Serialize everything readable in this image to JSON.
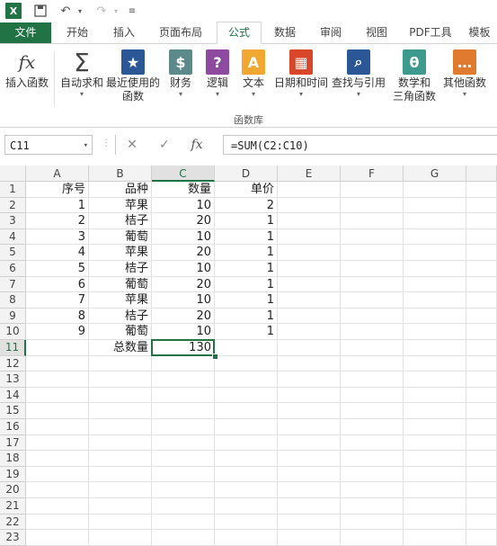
{
  "qat": {
    "logo": "X",
    "undo": "↶",
    "redo": "↷"
  },
  "tabs": [
    "文件",
    "开始",
    "插入",
    "页面布局",
    "公式",
    "数据",
    "审阅",
    "视图",
    "PDF工具",
    "模板"
  ],
  "ribbon": {
    "buttons": [
      {
        "label": "插入函数",
        "icon": "fx"
      },
      {
        "label": "自动求和",
        "icon": "Σ"
      },
      {
        "label": "最近使用的",
        "label2": "函数",
        "icon": "★"
      },
      {
        "label": "财务",
        "icon": "$"
      },
      {
        "label": "逻辑",
        "icon": "?"
      },
      {
        "label": "文本",
        "icon": "A"
      },
      {
        "label": "日期和时间",
        "icon": "▦"
      },
      {
        "label": "查找与引用",
        "icon": "⌕"
      },
      {
        "label": "数学和",
        "label2": "三角函数",
        "icon": "θ"
      },
      {
        "label": "其他函数",
        "icon": "…"
      }
    ],
    "group_label": "函数库"
  },
  "formula_bar": {
    "namebox": "C11",
    "cancel": "✕",
    "enter": "✓",
    "fx": "fx",
    "formula": "=SUM(C2:C10)"
  },
  "columns": [
    "A",
    "B",
    "C",
    "D",
    "E",
    "F",
    "G"
  ],
  "rows": [
    "1",
    "2",
    "3",
    "4",
    "5",
    "6",
    "7",
    "8",
    "9",
    "10",
    "11",
    "12",
    "13",
    "14",
    "15",
    "16",
    "17",
    "18",
    "19",
    "20",
    "21",
    "22",
    "23"
  ],
  "cells": {
    "r1": [
      "序号",
      "品种",
      "数量",
      "单价"
    ],
    "data": [
      [
        "1",
        "苹果",
        "10",
        "2"
      ],
      [
        "2",
        "桔子",
        "20",
        "1"
      ],
      [
        "3",
        "葡萄",
        "10",
        "1"
      ],
      [
        "4",
        "苹果",
        "20",
        "1"
      ],
      [
        "5",
        "桔子",
        "10",
        "1"
      ],
      [
        "6",
        "葡萄",
        "20",
        "1"
      ],
      [
        "7",
        "苹果",
        "10",
        "1"
      ],
      [
        "8",
        "桔子",
        "20",
        "1"
      ],
      [
        "9",
        "葡萄",
        "10",
        "1"
      ]
    ],
    "total_label": "总数量",
    "total_value": "130"
  },
  "colors": {
    "accent": "#217346"
  }
}
